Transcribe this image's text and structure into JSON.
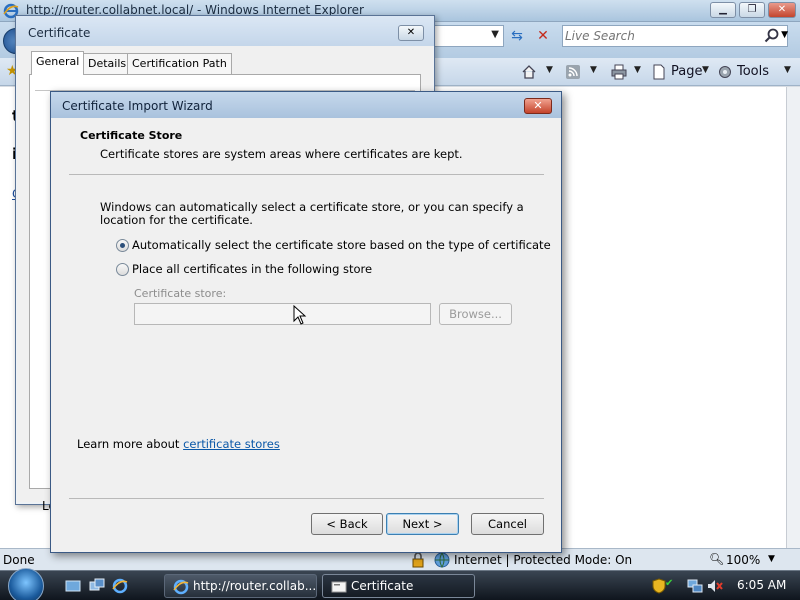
{
  "ie": {
    "title": "http://router.collabnet.local/ - Windows Internet Explorer",
    "search_placeholder": "Live Search",
    "cmd": {
      "page_label": "Page",
      "tools_label": "Tools"
    },
    "status": {
      "left": "Done",
      "zone": "Internet | Protected Mode: On",
      "zoom": "100%"
    },
    "content_fragments": {
      "f1": "t",
      "f2": "i",
      "f3": "C"
    }
  },
  "certificate": {
    "title": "Certificate",
    "tabs": [
      {
        "label": "General"
      },
      {
        "label": "Details"
      },
      {
        "label": "Certification Path"
      }
    ],
    "leftover_text": "Le"
  },
  "wizard": {
    "title": "Certificate Import Wizard",
    "header_title": "Certificate Store",
    "header_subtitle": "Certificate stores are system areas where certificates are kept.",
    "intro": "Windows can automatically select a certificate store, or you can specify a location for the certificate.",
    "option_auto": "Automatically select the certificate store based on the type of certificate",
    "option_manual": "Place all certificates in the following store",
    "store_label": "Certificate store:",
    "store_value": "",
    "browse_label": "Browse...",
    "learn_prefix": "Learn more about ",
    "learn_link": "certificate stores",
    "back_label": "< Back",
    "next_label": "Next >",
    "cancel_label": "Cancel",
    "selected_option": "auto"
  },
  "taskbar": {
    "tasks": [
      {
        "label": "http://router.collab..."
      },
      {
        "label": "Certificate"
      }
    ],
    "clock": "6:05 AM"
  }
}
